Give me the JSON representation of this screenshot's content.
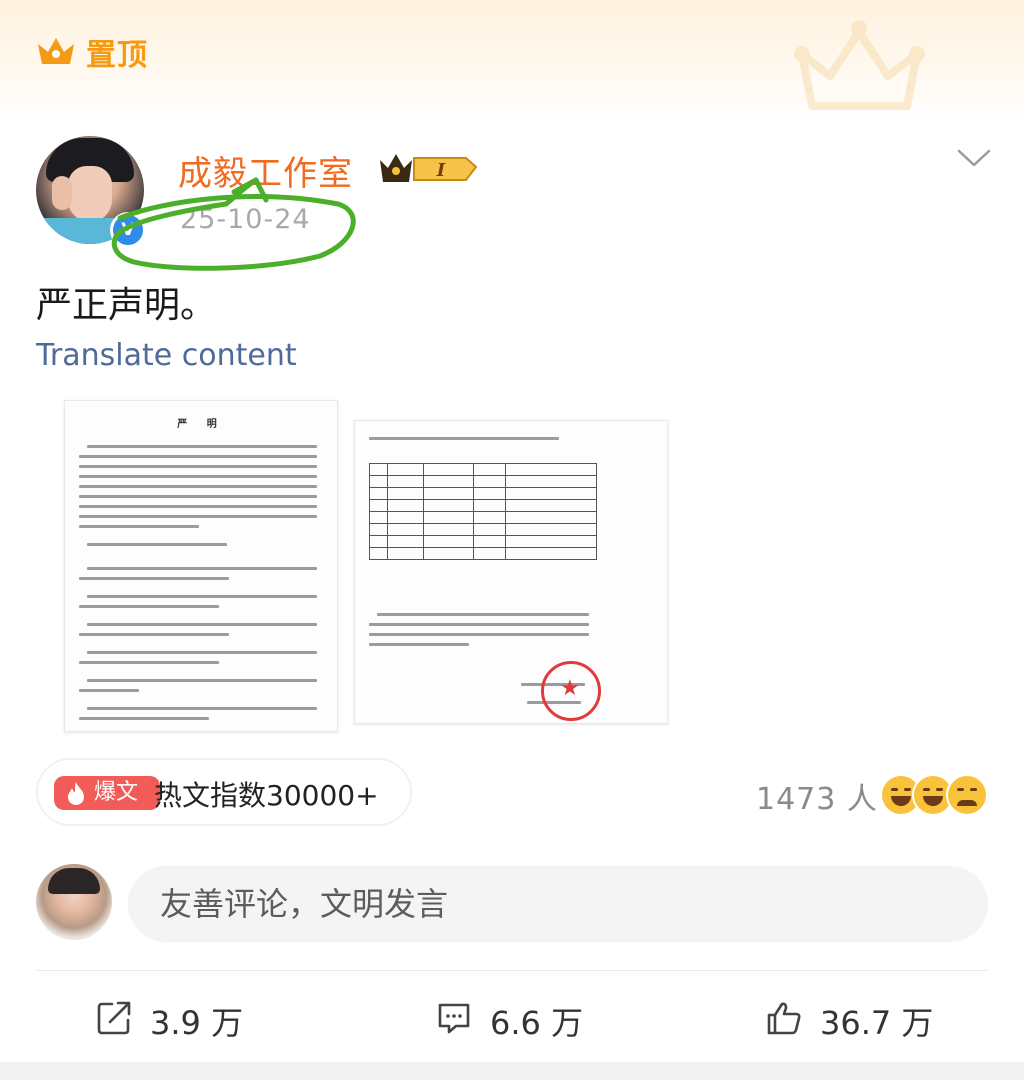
{
  "pinned": {
    "label": "置顶",
    "icon": "crown-icon"
  },
  "author": {
    "name": "成毅工作室",
    "vip_badge_text": "I",
    "date": "25-10-24",
    "verified_icon": "verified-v-icon",
    "verified_mark": "V"
  },
  "post": {
    "text": "严正声明。",
    "translate_label": "Translate content",
    "doc_title": "严 明"
  },
  "hot": {
    "tag": "爆文",
    "index_text": "热文指数30000+"
  },
  "reactions": {
    "count_text": "1473 人"
  },
  "comment": {
    "placeholder": "友善评论，文明发言"
  },
  "actions": {
    "share": "3.9 万",
    "comment": "6.6 万",
    "like": "36.7 万"
  },
  "colors": {
    "pinned": "#f59a14",
    "username": "#f06a1f",
    "link": "#4e6a99",
    "hot_tag": "#f25c58",
    "annotation": "#4caf2a"
  }
}
